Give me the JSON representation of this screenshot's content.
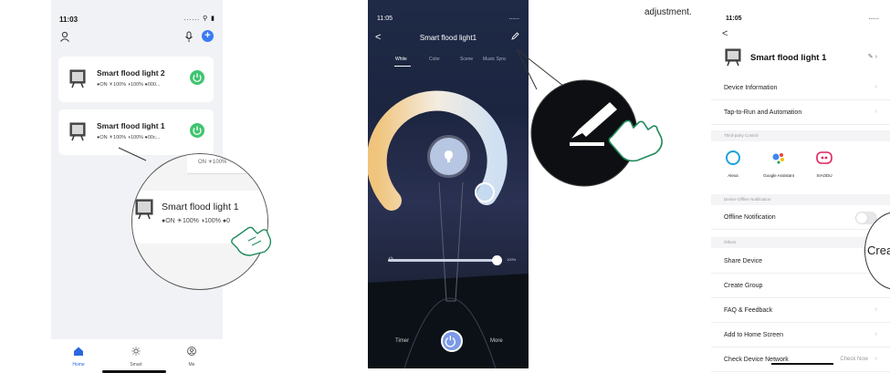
{
  "panel1": {
    "status_time": "11:03",
    "status_icons": "......",
    "add_label": "+",
    "devices": [
      {
        "name": "Smart flood light 2",
        "status": "●ON ☀100% ◑100% ●000..."
      },
      {
        "name": "Smart flood light 1",
        "status": "●ON ☀100% ◑100% ●00c..."
      }
    ],
    "zoom": {
      "strip_text": "ON ☀100%",
      "name": "Smart flood light 1",
      "status": "●ON ☀100% ◑100% ●0"
    },
    "tabs": [
      {
        "label": "Home"
      },
      {
        "label": "Smart"
      },
      {
        "label": "Me"
      }
    ]
  },
  "panel2": {
    "status_time": "11:05",
    "status_icons": "......",
    "back": "<",
    "title": "Smart flood light1",
    "tabs": [
      "White",
      "Color",
      "Scene",
      "Music Sync"
    ],
    "brightness_label": "100%",
    "brightness": 100,
    "timer_label": "Timer",
    "more_label": "More"
  },
  "caption": "adjustment.",
  "panel3": {
    "status_time": "11:05",
    "status_icons": "......",
    "back": "<",
    "device_name": "Smart flood light 1",
    "rows_top": [
      "Device Information",
      "Tap-to-Run and Automation"
    ],
    "section_third_party": "Third-party Control",
    "third_party": [
      {
        "name": "Alexa"
      },
      {
        "name": "Google Assistant"
      },
      {
        "name": "XIAODU"
      }
    ],
    "section_offline": "Device Offline Notification",
    "offline_row": "Offline Notification",
    "offline_enabled": false,
    "section_others": "Others",
    "rows_others": [
      "Share Device",
      "Create Group",
      "FAQ & Feedback",
      "Add to Home Screen",
      "Check Device Network"
    ],
    "check_now": "Check Now",
    "speech_text": "Crea"
  },
  "colors": {
    "accent_blue": "#3a7bf0",
    "power_green": "#3ec56f",
    "night_bg": "#1e2a46"
  }
}
